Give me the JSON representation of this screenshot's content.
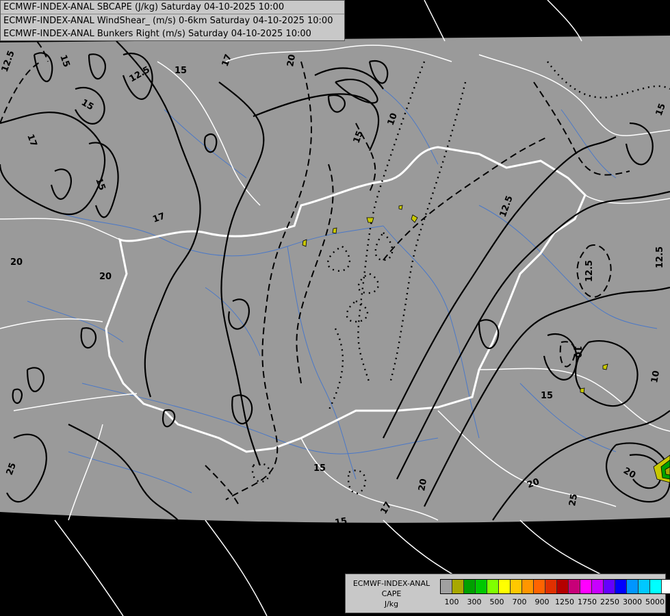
{
  "header": {
    "line1": "ECMWF-INDEX-ANAL SBCAPE (J/kg) Saturday 04-10-2025 10:00",
    "line2": "ECMWF-INDEX-ANAL WindShear_ (m/s) 0-6km Saturday 04-10-2025 10:00",
    "line3": "ECMWF-INDEX-ANAL Bunkers Right (m/s) Saturday 04-10-2025 10:00"
  },
  "legend": {
    "title_line1": "ECMWF-INDEX-ANAL",
    "title_line2": "CAPE",
    "title_line3": "J/kg",
    "colors": [
      "#a0a0a0",
      "#a8a800",
      "#00a000",
      "#00c800",
      "#80ff00",
      "#ffff00",
      "#ffc800",
      "#ff9600",
      "#ff6400",
      "#e03000",
      "#b40000",
      "#c80078",
      "#ff00ff",
      "#c800ff",
      "#6400ff",
      "#0000ff",
      "#0096ff",
      "#00c8ff",
      "#00ffff",
      "#ffffff"
    ],
    "tick_labels": [
      "100",
      "300",
      "500",
      "700",
      "900",
      "1250",
      "1750",
      "2250",
      "3000",
      "5000"
    ]
  },
  "contour_labels": [
    "12.5",
    "15",
    "12.5",
    "15",
    "17",
    "20",
    "15",
    "10",
    "15",
    "17",
    "17",
    "15",
    "20",
    "20",
    "12.5",
    "12.5",
    "12.5",
    "15",
    "10",
    "15",
    "20",
    "25",
    "17",
    "20",
    "15",
    "25",
    "20",
    "15",
    "15",
    "20",
    "15",
    "10",
    "25"
  ],
  "colors": {
    "domain": "#9a9a9a",
    "outside": "#000000",
    "border": "#ffffff",
    "river": "#4a78c8",
    "contour": "#000000"
  }
}
